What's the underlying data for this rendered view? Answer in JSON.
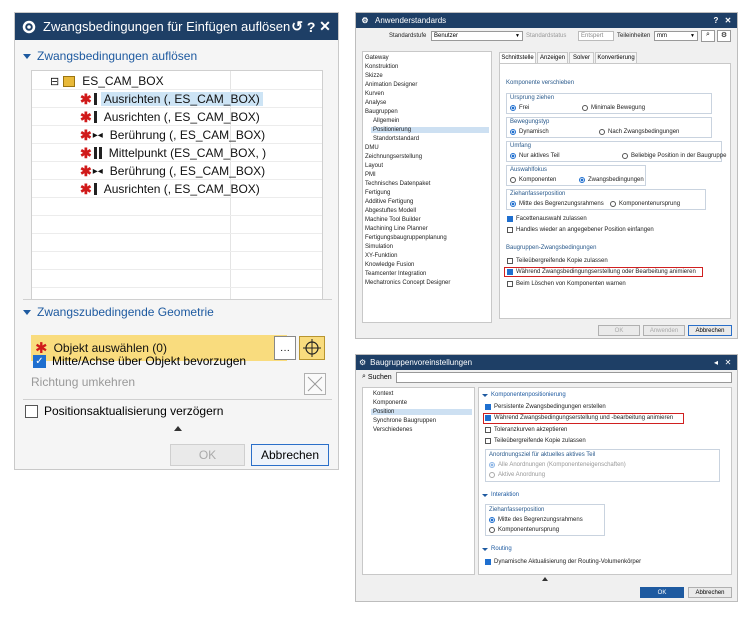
{
  "dialog1": {
    "title": "Zwangsbedingungen für Einfügen auflösen",
    "section1": "Zwangsbedingungen auflösen",
    "root": "ES_CAM_BOX",
    "rows": [
      "Ausrichten (, ES_CAM_BOX)",
      "Ausrichten (, ES_CAM_BOX)",
      "Berührung (, ES_CAM_BOX)",
      "Mittelpunkt (ES_CAM_BOX, )",
      "Berührung (, ES_CAM_BOX)",
      "Ausrichten (, ES_CAM_BOX)"
    ],
    "section2": "Zwangszubedingende Geometrie",
    "select_object": "Objekt auswählen (0)",
    "prefer_center": "Mitte/Achse über Objekt bevorzugen",
    "reverse_direction": "Richtung umkehren",
    "delay_update": "Positionsaktualisierung verzögern",
    "ok": "OK",
    "cancel": "Abbrechen"
  },
  "dialog2": {
    "title": "Anwenderstandards",
    "std_level_label": "Standardstufe",
    "std_level_value": "Benutzer",
    "std_status_label": "Standardstatus",
    "std_status_value": "Entspert",
    "unit_label": "Teileinheiten",
    "unit_value": "mm",
    "nav": [
      "Gateway",
      "Konstruktion",
      "Skizze",
      "Animation Designer",
      "Kurven",
      "Analyse",
      "Baugruppen",
      "Allgemein",
      "Positionierung",
      "Standortstandard",
      "DMU",
      "Zeichnungserstellung",
      "Layout",
      "PMI",
      "Technisches Datenpaket",
      "Fertigung",
      "Additive Fertigung",
      "Abgestuftes Modell",
      "Machine Tool Builder",
      "Machining Line Planner",
      "Fertigungsbaugruppenplanung",
      "Simulation",
      "XY-Funktion",
      "Knowledge Fusion",
      "Teamcenter Integration",
      "Mechatronics Concept Designer"
    ],
    "tabs": [
      "Schnittstelle",
      "Anzeigen",
      "Solver",
      "Konvertierung"
    ],
    "g_move": "Komponente verschieben",
    "g_origin": "Ursprung ziehen",
    "o_free": "Frei",
    "o_minmove": "Minimale Bewegung",
    "g_movetype": "Bewegungstyp",
    "o_dynamic": "Dynamisch",
    "o_after": "Nach Zwangsbedingungen",
    "g_scope": "Umfang",
    "o_active": "Nur aktives Teil",
    "o_any": "Beliebige Position in der Baugruppe",
    "g_focus": "Auswahlfokus",
    "o_components": "Komponenten",
    "o_constraints": "Zwangsbedingungen",
    "g_handle": "Ziehanfasserposition",
    "o_center": "Mitte des Begrenzungsrahmens",
    "o_origin": "Komponentenursprung",
    "c_facet": "Facettenauswahl zulassen",
    "c_handles": "Handles wieder an angegebener Position einfangen",
    "g_asm": "Baugruppen-Zwangsbedingungen",
    "c_cross": "Teileübergreifende Kopie zulassen",
    "c_animate": "Während Zwangsbedingungserstellung oder Bearbeitung animieren",
    "c_warn": "Beim Löschen von Komponenten warnen",
    "ok": "OK",
    "apply": "Anwenden",
    "cancel": "Abbrechen"
  },
  "dialog3": {
    "title": "Baugruppenvoreinstellungen",
    "search_label": "Suchen",
    "search_value": "",
    "nav": [
      "Kontext",
      "Komponente",
      "Position",
      "Synchrone Baugruppen",
      "Verschiedenes"
    ],
    "s_position": "Komponentenpositionierung",
    "c_persist": "Persistente Zwangsbedingungen erstellen",
    "c_animate": "Während Zwangsbedingungserstellung und -bearbeitung animieren",
    "c_tol": "Toleranzkurven akzeptieren",
    "c_cross": "Teileübergreifende Kopie zulassen",
    "arr_title": "Anordnungsziel für aktuelles aktives Teil",
    "o_all": "Alle Anordnungen (Komponenteneigenschaften)",
    "o_active": "Aktive Anordnung",
    "s_interaction": "Interaktion",
    "handle_title": "Ziehanfasserposition",
    "o_center": "Mitte des Begrenzungsrahmens",
    "o_origin": "Komponentenursprung",
    "s_routing": "Routing",
    "c_routing": "Dynamische Aktualisierung der Routing-Volumenkörper",
    "ok": "OK",
    "cancel": "Abbrechen"
  }
}
